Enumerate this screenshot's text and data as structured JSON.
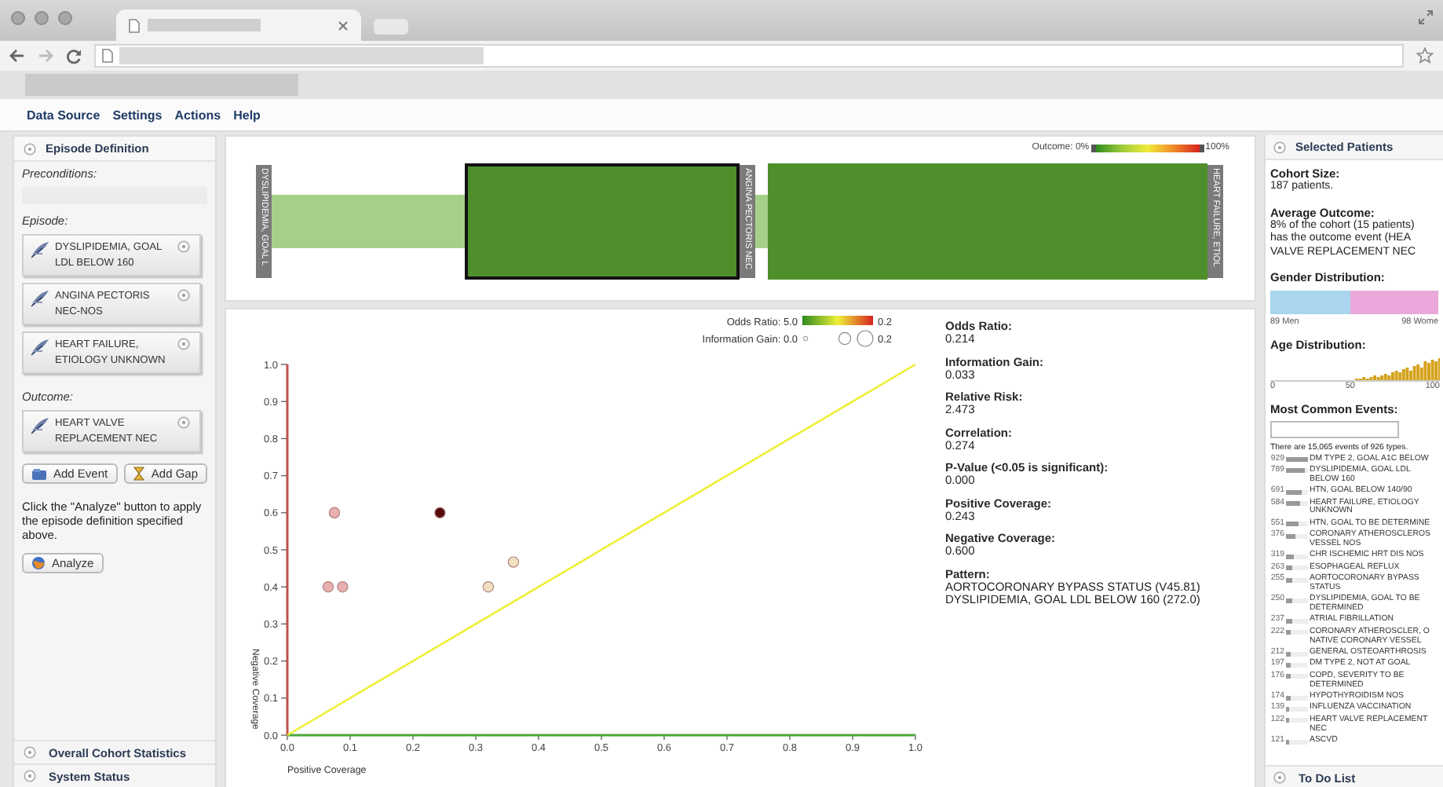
{
  "menu": [
    "Data Source",
    "Settings",
    "Actions",
    "Help"
  ],
  "episode_panel": {
    "title": "Episode Definition",
    "preconditions_label": "Preconditions:",
    "episode_label": "Episode:",
    "episode_events": [
      {
        "label": "DYSLIPIDEMIA, GOAL LDL BELOW 160"
      },
      {
        "label": "ANGINA PECTORIS NEC-NOS"
      },
      {
        "label": "HEART FAILURE, ETIOLOGY UNKNOWN"
      }
    ],
    "outcome_label": "Outcome:",
    "outcome_event": {
      "label": "HEART VALVE REPLACEMENT NEC"
    },
    "buttons": [
      {
        "kind": "event",
        "label": "Add Event"
      },
      {
        "kind": "gap",
        "label": "Add Gap"
      }
    ],
    "instructions": "Click the \"Analyze\" button to apply the episode definition specified above.",
    "analyze_button": "Analyze"
  },
  "left_collapsed_panels": [
    "Overall Cohort Statistics",
    "System Status"
  ],
  "sequence": {
    "legend_min": "Outcome: 0%",
    "legend_max": "100%",
    "events": [
      {
        "label": "DYSLIPIDEMIA, GOAL L",
        "selected": false
      },
      {
        "label": "ANGINA PECTORIS NEC",
        "selected": true
      },
      {
        "label": "HEART FAILURE, ETIOL",
        "selected": false
      }
    ]
  },
  "scatter": {
    "odds_legend": {
      "label": "Odds Ratio: 5.0",
      "max": "0.2"
    },
    "gain_legend": {
      "label": "Information Gain: 0.0",
      "max": "0.2"
    },
    "chart_data": {
      "type": "scatter",
      "xlabel": "Positive Coverage",
      "ylabel": "Negative Coverage",
      "xlim": [
        0,
        1
      ],
      "ylim": [
        0,
        1
      ],
      "xticks": [
        {
          "value": 0,
          "label": "0.0"
        },
        {
          "value": 0.1,
          "label": "0.1"
        },
        {
          "value": 0.2,
          "label": "0.2"
        },
        {
          "value": 0.3,
          "label": "0.3"
        },
        {
          "value": 0.4,
          "label": "0.4"
        },
        {
          "value": 0.5,
          "label": "0.5"
        },
        {
          "value": 0.6,
          "label": "0.6"
        },
        {
          "value": 0.7,
          "label": "0.7"
        },
        {
          "value": 0.8,
          "label": "0.8"
        },
        {
          "value": 0.9,
          "label": "0.9"
        },
        {
          "value": 1,
          "label": "1.0"
        }
      ],
      "yticks": [
        {
          "value": 0,
          "label": "0.0"
        },
        {
          "value": 0.1,
          "label": "0.1"
        },
        {
          "value": 0.2,
          "label": "0.2"
        },
        {
          "value": 0.3,
          "label": "0.3"
        },
        {
          "value": 0.4,
          "label": "0.4"
        },
        {
          "value": 0.5,
          "label": "0.5"
        },
        {
          "value": 0.6,
          "label": "0.6"
        },
        {
          "value": 0.7,
          "label": "0.7"
        },
        {
          "value": 0.8,
          "label": "0.8"
        },
        {
          "value": 0.9,
          "label": "0.9"
        },
        {
          "value": 1,
          "label": "1.0"
        }
      ],
      "series": [
        {
          "color": "#e8b0b0",
          "x": [
            0.065,
            0.088,
            0.075
          ],
          "values": [
            0.4,
            0.4,
            0.6
          ]
        },
        {
          "color": "#5a0c0c",
          "x": [
            0.243
          ],
          "values": [
            0.6
          ]
        },
        {
          "color": "#f0e2c0",
          "x": [
            0.32,
            0.36
          ],
          "values": [
            0.4,
            0.467
          ]
        },
        {
          "type": "line",
          "color": "#eeee33",
          "x": [
            0,
            1
          ],
          "values": [
            0,
            1
          ]
        }
      ]
    }
  },
  "stats": [
    {
      "label": "Odds Ratio:",
      "lines": [
        "0.214"
      ]
    },
    {
      "label": "Information Gain:",
      "lines": [
        "0.033"
      ]
    },
    {
      "label": "Relative Risk:",
      "lines": [
        "2.473"
      ]
    },
    {
      "label": "Correlation:",
      "lines": [
        "0.274"
      ]
    },
    {
      "label": "P-Value (<0.05 is significant):",
      "lines": [
        "0.000"
      ]
    },
    {
      "label": "Positive Coverage:",
      "lines": [
        "0.243"
      ]
    },
    {
      "label": "Negative Coverage:",
      "lines": [
        "0.600"
      ]
    },
    {
      "label": "Pattern:",
      "lines": [
        "AORTOCORONARY BYPASS STATUS (V45.81)",
        "DYSLIPIDEMIA, GOAL LDL BELOW 160 (272.0)"
      ]
    }
  ],
  "selected_patients": {
    "title": "Selected Patients",
    "cohort_label": "Cohort Size:",
    "cohort_value": "187 patients.",
    "outcome_label": "Average Outcome:",
    "outcome_lines": [
      "8% of the cohort (15 patients)",
      "has the outcome event (HEA",
      "VALVE REPLACEMENT NEC"
    ],
    "gender_label": "Gender Distribution:",
    "gender": {
      "level": 0.476,
      "men": "89 Men",
      "women": "98 Wome"
    },
    "age_label": "Age Distribution:",
    "age_ticks": [
      "0",
      "50",
      "100"
    ],
    "events_label": "Most Common Events:",
    "events_summary": "There are 15,065 events of 926 types.",
    "events": [
      {
        "count": "929",
        "level": 1,
        "name": "DM TYPE 2, GOAL A1C BELOW"
      },
      {
        "count": "789",
        "level": 0.85,
        "name": "DYSLIPIDEMIA, GOAL LDL BELOW 160"
      },
      {
        "count": "691",
        "level": 0.74,
        "name": "HTN, GOAL BELOW 140/90"
      },
      {
        "count": "584",
        "level": 0.63,
        "name": "HEART FAILURE, ETIOLOGY UNKNOWN"
      },
      {
        "count": "551",
        "level": 0.59,
        "name": "HTN, GOAL TO BE DETERMINE"
      },
      {
        "count": "376",
        "level": 0.4,
        "name": "CORONARY ATHEROSCLEROS VESSEL NOS"
      },
      {
        "count": "319",
        "level": 0.34,
        "name": "CHR ISCHEMIC HRT DIS NOS"
      },
      {
        "count": "263",
        "level": 0.28,
        "name": "ESOPHAGEAL REFLUX"
      },
      {
        "count": "255",
        "level": 0.27,
        "name": "AORTOCORONARY BYPASS STATUS"
      },
      {
        "count": "250",
        "level": 0.27,
        "name": "DYSLIPIDEMIA, GOAL TO BE DETERMINED"
      },
      {
        "count": "237",
        "level": 0.26,
        "name": "ATRIAL FIBRILLATION"
      },
      {
        "count": "222",
        "level": 0.24,
        "name": "CORONARY ATHEROSCLER, O NATIVE CORONARY VESSEL"
      },
      {
        "count": "212",
        "level": 0.23,
        "name": "GENERAL OSTEOARTHROSIS"
      },
      {
        "count": "197",
        "level": 0.21,
        "name": "DM TYPE 2, NOT AT GOAL"
      },
      {
        "count": "176",
        "level": 0.19,
        "name": "COPD, SEVERITY TO BE DETERMINED"
      },
      {
        "count": "174",
        "level": 0.19,
        "name": "HYPOTHYROIDISM NOS"
      },
      {
        "count": "139",
        "level": 0.15,
        "name": "INFLUENZA VACCINATION"
      },
      {
        "count": "122",
        "level": 0.13,
        "name": "HEART VALVE REPLACEMENT NEC"
      },
      {
        "count": "121",
        "level": 0.13,
        "name": "ASCVD"
      }
    ]
  },
  "right_collapsed_panels": [
    "To Do List"
  ]
}
